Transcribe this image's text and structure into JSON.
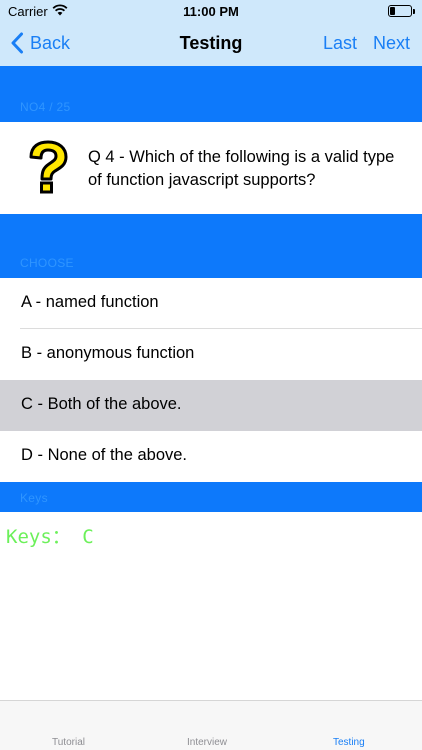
{
  "status_bar": {
    "carrier": "Carrier",
    "time": "11:00 PM"
  },
  "nav": {
    "back_label": "Back",
    "title": "Testing",
    "last_label": "Last",
    "next_label": "Next"
  },
  "progress_label": "NO4 / 25",
  "question": {
    "text": "Q 4 - Which of the following is a valid type of function javascript supports?"
  },
  "choose_label": "CHOOSE",
  "options": [
    {
      "label": "A - named function",
      "selected": false
    },
    {
      "label": "B - anonymous function",
      "selected": false
    },
    {
      "label": "C - Both of the above.",
      "selected": true
    },
    {
      "label": "D - None of the above.",
      "selected": false
    }
  ],
  "keys_section_label": "Keys",
  "answer": "Keys： C",
  "tabs": [
    {
      "label": "Tutorial",
      "active": false
    },
    {
      "label": "Interview",
      "active": false
    },
    {
      "label": "Testing",
      "active": true
    }
  ],
  "colors": {
    "accent": "#1a7ff5",
    "band": "#0d79fb",
    "nav_bg": "#cfe8fb",
    "answer": "#6cf05a",
    "selected_row": "#d1d1d6"
  },
  "icons": [
    "wifi-icon",
    "battery-icon",
    "back-chevron-icon",
    "question-mark-icon"
  ]
}
